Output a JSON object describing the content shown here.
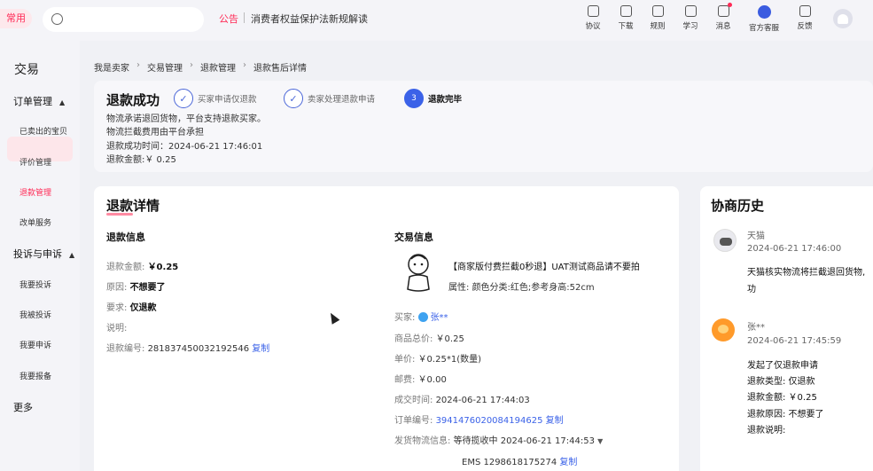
{
  "topbar": {
    "common_tag": "常用",
    "search_placeholder": "",
    "notice_label": "公告",
    "notice_text": "消费者权益保护法新规解读",
    "tools": [
      {
        "label": "协议",
        "icon": "agreement-icon"
      },
      {
        "label": "下载",
        "icon": "download-icon"
      },
      {
        "label": "规则",
        "icon": "rules-icon"
      },
      {
        "label": "学习",
        "icon": "learn-icon"
      },
      {
        "label": "消息",
        "icon": "message-icon",
        "badge": true
      },
      {
        "label": "官方客服",
        "icon": "customer-service-icon"
      },
      {
        "label": "反馈",
        "icon": "feedback-icon"
      }
    ]
  },
  "sidebar": {
    "title": "交易",
    "groups": [
      {
        "label": "订单管理",
        "items": [
          "已卖出的宝贝",
          "评价管理",
          "退款管理",
          "改单服务"
        ]
      },
      {
        "label": "投诉与申诉",
        "items": [
          "我要投诉",
          "我被投诉",
          "我要申诉",
          "我要报备"
        ]
      }
    ],
    "more": "更多",
    "active_item": "退款管理"
  },
  "breadcrumb": [
    "我是卖家",
    "交易管理",
    "退款管理",
    "退款售后详情"
  ],
  "status": {
    "title": "退款成功",
    "steps": [
      {
        "label": "买家申请仅退款",
        "mark": "✓"
      },
      {
        "label": "卖家处理退款申请",
        "mark": "✓"
      },
      {
        "label": "退款完毕",
        "mark": "3"
      }
    ],
    "lines": [
      "物流承诺退回货物，平台支持退款买家。",
      "物流拦截费用由平台承担",
      "退款成功时间：2024-06-21 17:46:01",
      "退款金额:￥ 0.25"
    ]
  },
  "detail": {
    "title": "退款详情",
    "refund_info": {
      "title": "退款信息",
      "amount_key": "退款金额:",
      "amount": "￥0.25",
      "reason_key": "原因:",
      "reason": "不想要了",
      "request_key": "要求:",
      "request": "仅退款",
      "note_key": "说明:",
      "number_key": "退款编号:",
      "number": "2818374500321925​46",
      "copy": "复制"
    },
    "trade_info": {
      "title": "交易信息",
      "product_name": "【商家版付费拦截0秒退】UAT测试商品请不要拍",
      "product_attr_key": "属性:",
      "product_attr": "颜色分类:红色;参考身高:52cm",
      "buyer_key": "买家:",
      "buyer": "张**",
      "total_key": "商品总价:",
      "total": "￥0.25",
      "unit_key": "单价:",
      "unit": "￥0.25*1(数量)",
      "postage_key": "邮费:",
      "postage": "￥0.00",
      "deal_time_key": "成交时间:",
      "deal_time": "2024-06-21 17:44:03",
      "order_no_key": "订单编号:",
      "order_no": "3941476020084194625",
      "copy": "复制",
      "logistics_key": "发货物流信息:",
      "logistics_status": "等待揽收中 2024-06-21 17:44:53",
      "ems": "EMS 1298618175274",
      "ems_copy": "复制"
    }
  },
  "negotiation": {
    "title": "协商历史",
    "entries": [
      {
        "name": "天猫",
        "time": "2024-06-21 17:46:00",
        "lines": [
          "天猫核实物流将拦截退回货物,",
          "功"
        ]
      },
      {
        "name": "张**",
        "time": "2024-06-21 17:45:59",
        "lines": [
          "发起了仅退款申请",
          "退款类型: 仅退款",
          "退款金额: ￥0.25",
          "退款原因: 不想要了",
          "退款说明:"
        ]
      }
    ]
  },
  "colors": {
    "accent": "#ff2a56",
    "link": "#3b62e8"
  }
}
